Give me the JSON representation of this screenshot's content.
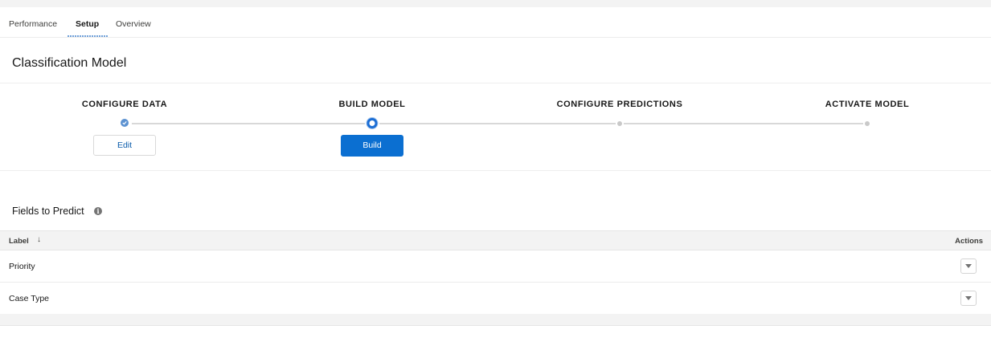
{
  "tabs": [
    {
      "label": "Performance",
      "active": false
    },
    {
      "label": "Setup",
      "active": true
    },
    {
      "label": "Overview",
      "active": false
    }
  ],
  "page_title": "Classification Model",
  "path": {
    "steps": [
      {
        "label": "CONFIGURE DATA",
        "status": "complete",
        "button": "Edit"
      },
      {
        "label": "BUILD MODEL",
        "status": "current",
        "button": "Build"
      },
      {
        "label": "CONFIGURE PREDICTIONS",
        "status": "incomplete"
      },
      {
        "label": "ACTIVATE MODEL",
        "status": "incomplete"
      }
    ],
    "colors": {
      "complete": "#5c92d1",
      "current": "#1b6dd4",
      "incomplete": "#c9c9c9",
      "brand_button": "#0b6fd1"
    }
  },
  "fields_section": {
    "title": "Fields to Predict",
    "info_icon": "info-icon",
    "columns": {
      "label": "Label",
      "actions": "Actions"
    },
    "sort_icon": "arrow-down-icon",
    "rows": [
      {
        "label": "Priority"
      },
      {
        "label": "Case Type"
      }
    ]
  }
}
